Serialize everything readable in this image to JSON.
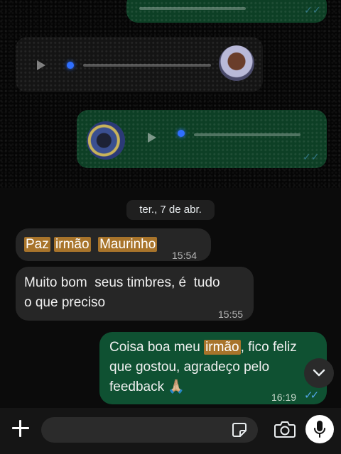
{
  "chat": {
    "date_separator": "ter., 7 de abr.",
    "messages": [
      {
        "direction": "incoming",
        "parts": [
          "Paz",
          " ",
          "irmão",
          "  ",
          "Maurinho"
        ],
        "time": "15:54"
      },
      {
        "direction": "incoming",
        "line1": "Muito bom  seus timbres, é  tudo",
        "line2": "o que preciso",
        "time": "15:55"
      },
      {
        "direction": "outgoing",
        "line1_before": "Coisa boa meu ",
        "line1_highlight": "irmão",
        "line1_after": ", fico feliz",
        "line2": "que gostou, agradeço pelo",
        "line3": "feedback 🙏🏼",
        "time": "16:19",
        "status": "read"
      }
    ]
  },
  "composer": {
    "input_value": "",
    "placeholder": ""
  },
  "icons": {
    "attach": "plus-icon",
    "sticker": "sticker-icon",
    "camera": "camera-icon",
    "mic": "microphone-icon",
    "scroll": "chevron-down-icon"
  },
  "colors": {
    "outgoing_bubble": "#0f5132",
    "incoming_bubble": "#262626",
    "highlight": "#a8742b",
    "read_ticks": "#53a6e8"
  }
}
